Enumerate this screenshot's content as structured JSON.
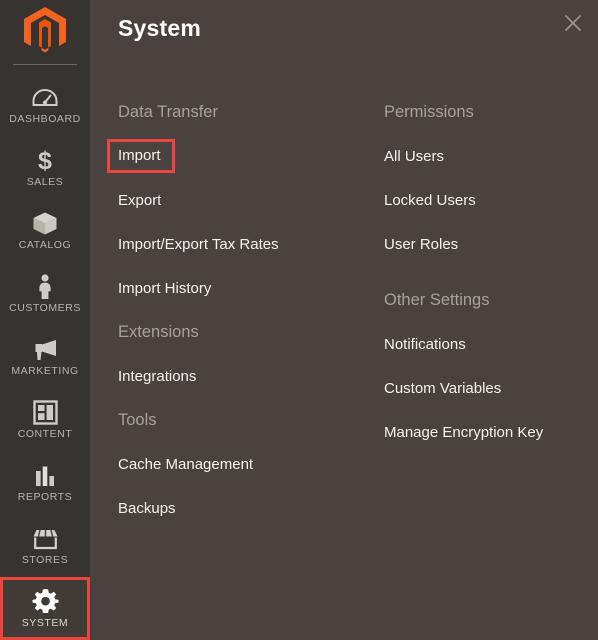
{
  "brand": {
    "logo_icon": "magento-logo-icon",
    "accent_color": "#f26322"
  },
  "highlight_color": "#e8473f",
  "sidebar": {
    "items": [
      {
        "label": "DASHBOARD",
        "icon": "dashboard-gauge-icon",
        "selected": false
      },
      {
        "label": "SALES",
        "icon": "dollar-sign-icon",
        "selected": false
      },
      {
        "label": "CATALOG",
        "icon": "box-icon",
        "selected": false
      },
      {
        "label": "CUSTOMERS",
        "icon": "person-icon",
        "selected": false
      },
      {
        "label": "MARKETING",
        "icon": "megaphone-icon",
        "selected": false
      },
      {
        "label": "CONTENT",
        "icon": "layout-grid-icon",
        "selected": false
      },
      {
        "label": "REPORTS",
        "icon": "bar-chart-icon",
        "selected": false
      },
      {
        "label": "STORES",
        "icon": "storefront-icon",
        "selected": false
      },
      {
        "label": "SYSTEM",
        "icon": "gear-icon",
        "selected": true
      }
    ]
  },
  "panel": {
    "title": "System",
    "close_icon": "close-icon",
    "left_column": [
      {
        "heading": "Data Transfer",
        "links": [
          {
            "label": "Import",
            "highlighted": true
          },
          {
            "label": "Export",
            "highlighted": false
          },
          {
            "label": "Import/Export Tax Rates",
            "highlighted": false
          },
          {
            "label": "Import History",
            "highlighted": false
          }
        ]
      },
      {
        "heading": "Extensions",
        "links": [
          {
            "label": "Integrations",
            "highlighted": false
          }
        ]
      },
      {
        "heading": "Tools",
        "links": [
          {
            "label": "Cache Management",
            "highlighted": false
          },
          {
            "label": "Backups",
            "highlighted": false
          }
        ]
      }
    ],
    "right_column": [
      {
        "heading": "Permissions",
        "links": [
          {
            "label": "All Users",
            "highlighted": false
          },
          {
            "label": "Locked Users",
            "highlighted": false
          },
          {
            "label": "User Roles",
            "highlighted": false
          }
        ]
      },
      {
        "heading": "Other Settings",
        "links": [
          {
            "label": "Notifications",
            "highlighted": false
          },
          {
            "label": "Custom Variables",
            "highlighted": false
          },
          {
            "label": "Manage Encryption Key",
            "highlighted": false
          }
        ]
      }
    ]
  }
}
